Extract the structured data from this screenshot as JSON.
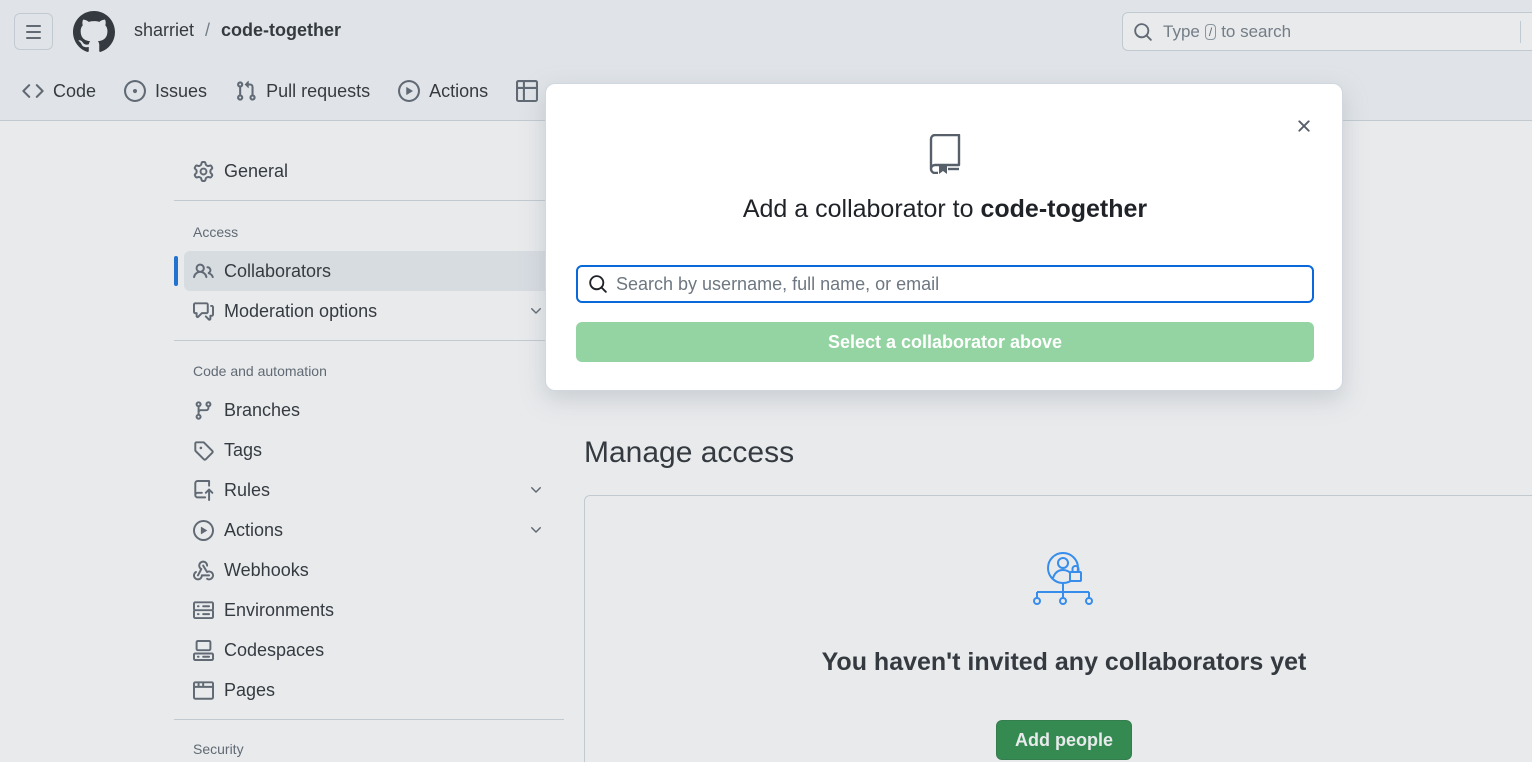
{
  "header": {
    "owner": "sharriet",
    "separator": "/",
    "repo": "code-together",
    "search": {
      "prefix": "Type",
      "key": "/",
      "suffix": "to search"
    }
  },
  "tabs": [
    {
      "label": "Code",
      "icon": "code-icon"
    },
    {
      "label": "Issues",
      "icon": "issue-icon"
    },
    {
      "label": "Pull requests",
      "icon": "pull-request-icon"
    },
    {
      "label": "Actions",
      "icon": "play-icon"
    },
    {
      "label": "",
      "icon": "table-icon"
    }
  ],
  "sidebar": {
    "general": "General",
    "access_heading": "Access",
    "collaborators": "Collaborators",
    "moderation": "Moderation options",
    "code_heading": "Code and automation",
    "branches": "Branches",
    "tags": "Tags",
    "rules": "Rules",
    "actions": "Actions",
    "webhooks": "Webhooks",
    "environments": "Environments",
    "codespaces": "Codespaces",
    "pages": "Pages",
    "security_heading": "Security"
  },
  "main": {
    "title": "Manage access",
    "empty_text": "You haven't invited any collaborators yet",
    "add_people": "Add people"
  },
  "modal": {
    "title_prefix": "Add a collaborator to",
    "title_repo": "code-together",
    "search_placeholder": "Search by username, full name, or email",
    "search_value": "",
    "submit_label": "Select a collaborator above"
  },
  "colors": {
    "accent": "#0969da",
    "primary_button": "#1f883d",
    "disabled_button": "#94d3a2"
  }
}
